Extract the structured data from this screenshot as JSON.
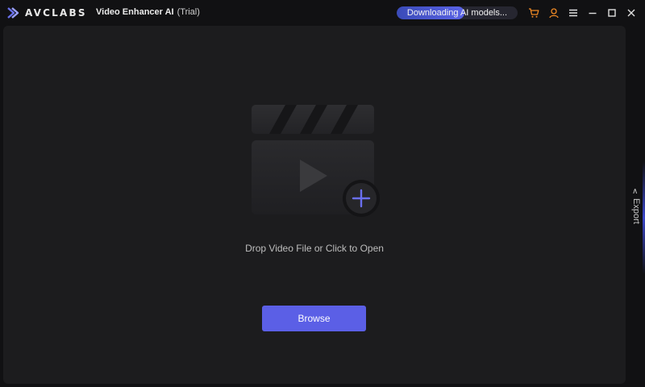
{
  "app": {
    "brand": "AVCLABS",
    "title": "Video Enhancer AI",
    "edition": "(Trial)"
  },
  "download": {
    "label": "Downloading AI models...",
    "progress_percent": 56
  },
  "toolbar": {
    "icons": [
      "cart-icon",
      "user-icon",
      "menu-icon",
      "minimize-icon",
      "maximize-icon",
      "close-icon"
    ]
  },
  "main": {
    "drop_text": "Drop Video File or Click to Open",
    "browse_label": "Browse"
  },
  "side": {
    "export_label": "Export"
  },
  "colors": {
    "accent": "#5b5fe6",
    "icon_orange": "#f08a24",
    "panel": "#1c1c1e",
    "background": "#111113"
  }
}
